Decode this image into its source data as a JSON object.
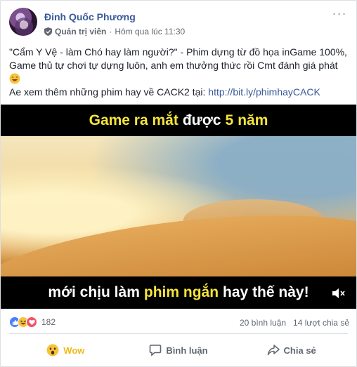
{
  "post": {
    "author": "Đinh Quốc Phương",
    "role": "Quản trị viên",
    "separator": "·",
    "time": "Hôm qua lúc 11:30",
    "text_line1": "\"Cẩm Y Vệ - làm Chó hay làm người?\" - Phim dựng từ đồ họa inGame 100%, Game thủ tự chơi tự dựng luôn, anh em thưởng thức rồi Cmt đánh giá phát",
    "text_line2_prefix": "Ae xem thêm những phim hay về CACK2 tại:",
    "link": "http://bit.ly/phimhayCACK"
  },
  "video": {
    "caption_top": [
      {
        "text": "Game ra mắt",
        "color": "#f5e53b"
      },
      {
        "text": "được",
        "color": "#ffffff"
      },
      {
        "text": "5",
        "color": "#f5e53b"
      },
      {
        "text": "năm",
        "color": "#f5e53b"
      }
    ],
    "caption_bottom": [
      {
        "text": "mới chịu làm",
        "color": "#ffffff"
      },
      {
        "text": "phim ngắn",
        "color": "#f5e53b"
      },
      {
        "text": "hay thế này!",
        "color": "#ffffff"
      }
    ],
    "muted": true
  },
  "stats": {
    "reaction_icons": [
      "like",
      "haha",
      "love"
    ],
    "reaction_count": "182",
    "comments": "20 bình luận",
    "shares": "14 lượt chia sẻ"
  },
  "actions": {
    "wow_label": "Wow",
    "comment_label": "Bình luận",
    "share_label": "Chia sẻ"
  },
  "colors": {
    "author_link": "#385898",
    "wow_active": "#f0ba15",
    "caption_yellow": "#f5e53b"
  }
}
